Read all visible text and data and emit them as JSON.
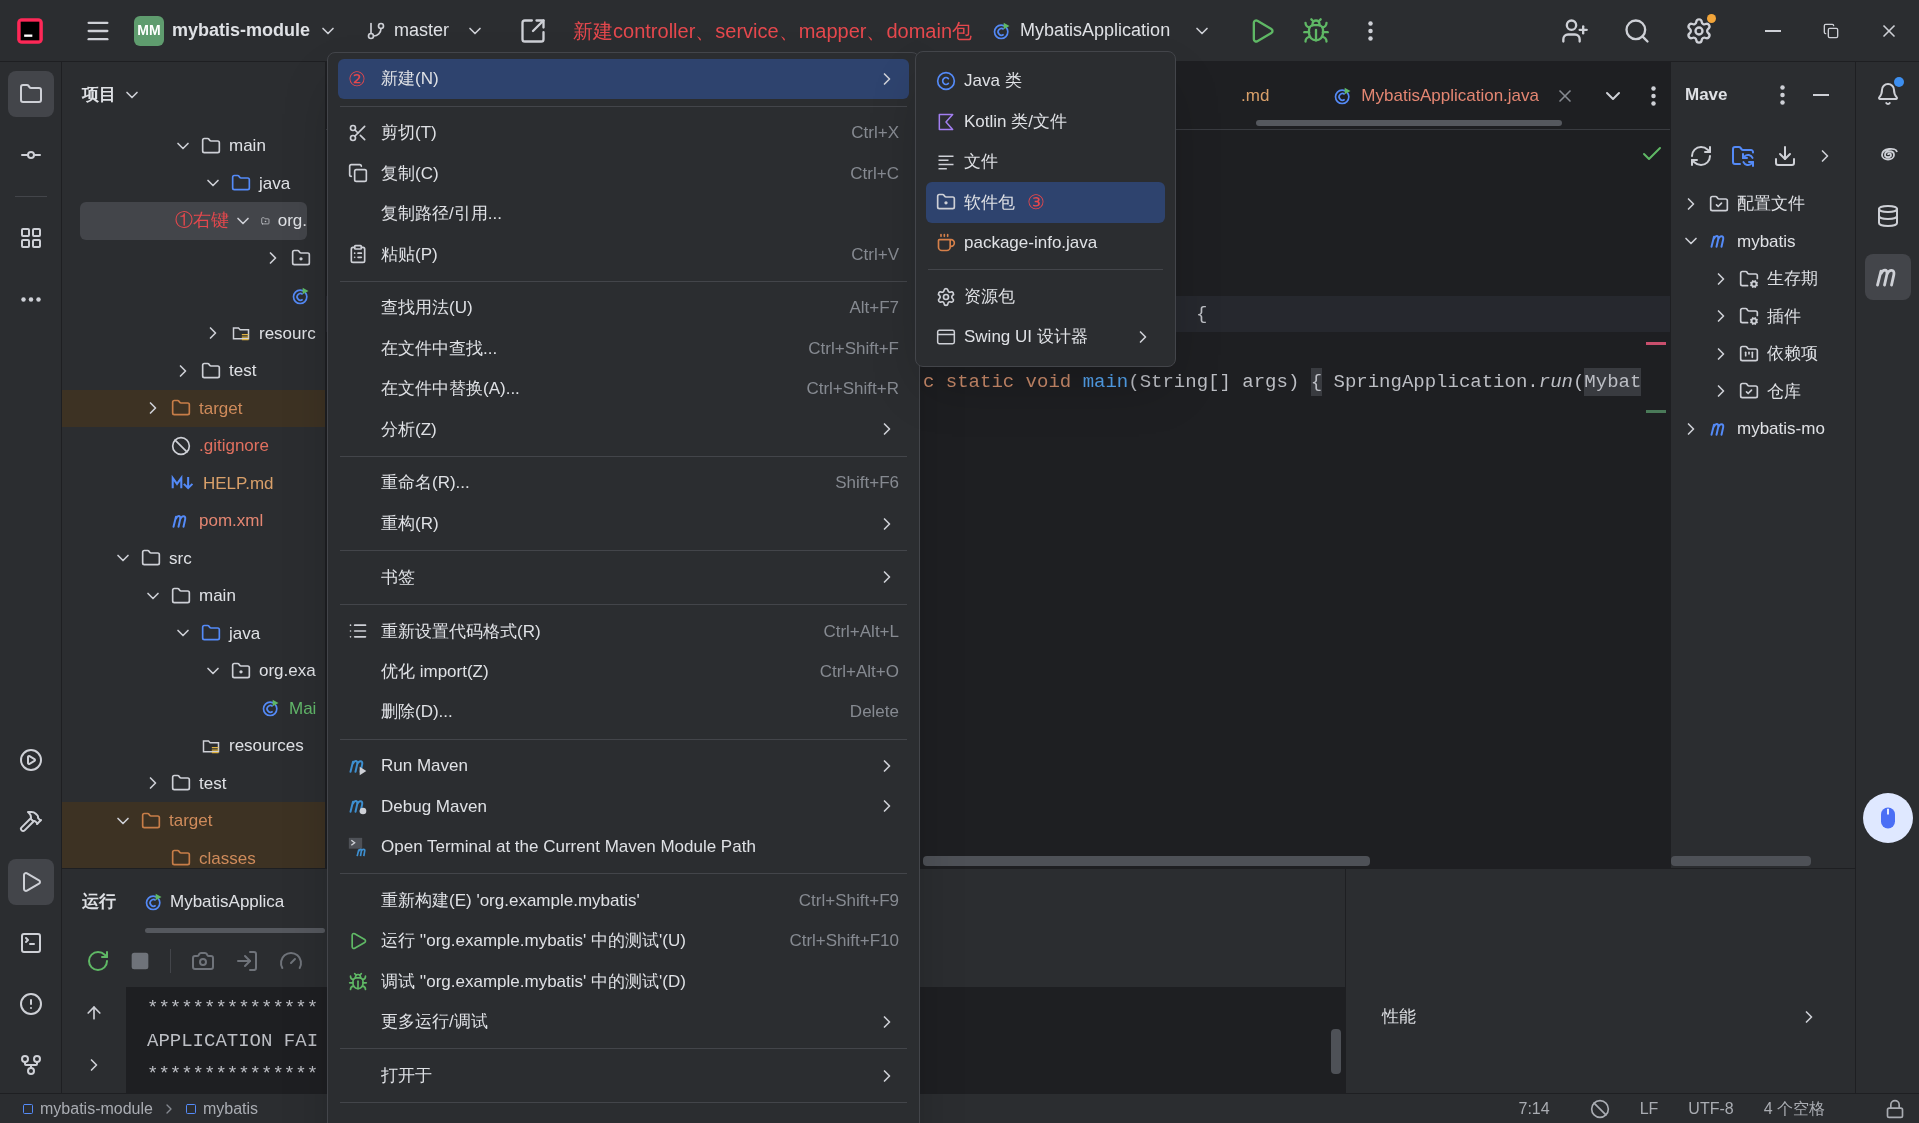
{
  "title_bar": {
    "project_badge": "MM",
    "project": "mybatis-module",
    "branch": "master",
    "annotation": "新建controller、service、mapper、domain包",
    "run_config": "MybatisApplication",
    "settings_badge": true
  },
  "left_toolbar": {
    "top": [
      {
        "kind": "project",
        "selected": true
      },
      {
        "kind": "commit",
        "selected": false
      },
      {
        "kind": "structure",
        "selected": false
      },
      {
        "kind": "more",
        "selected": false
      }
    ],
    "bottom": [
      {
        "kind": "services",
        "selected": false
      },
      {
        "kind": "build",
        "selected": false
      },
      {
        "kind": "run",
        "selected": true
      },
      {
        "kind": "terminal",
        "selected": false
      },
      {
        "kind": "problems",
        "selected": false
      },
      {
        "kind": "git",
        "selected": false
      }
    ]
  },
  "project_panel": {
    "title": "项目",
    "tree": [
      {
        "children": [
          {
            "children": [
              {
                "kind": "folder",
                "label": "main",
                "expanded": true,
                "selected": false,
                "children": [
                  {
                    "kind": "source",
                    "label": "java",
                    "expanded": true,
                    "selected": false,
                    "children": [
                      {
                        "kind": "package",
                        "label": "org.",
                        "expanded": true,
                        "selected": true,
                        "annotation": "①右键",
                        "children": [
                          {
                            "kind": "package",
                            "expanded": false,
                            "selected": false
                          },
                          {
                            "kind": "app_class",
                            "selected": false
                          }
                        ]
                      }
                    ]
                  },
                  {
                    "kind": "resources",
                    "label": "resourc",
                    "expanded": false,
                    "selected": false
                  }
                ]
              },
              {
                "kind": "folder",
                "label": "test",
                "expanded": false,
                "selected": false
              }
            ]
          },
          {
            "kind": "excluded",
            "label": "target",
            "expanded": false,
            "selected": false,
            "excluded": true,
            "color": "#cf8b5b"
          },
          {
            "kind": "gitignore",
            "label": ".gitignore",
            "selected": false,
            "color": "#e0705f"
          },
          {
            "kind": "markdown",
            "label": "HELP.md",
            "selected": false,
            "color": "#d9a06a"
          },
          {
            "kind": "maven",
            "label": "pom.xml",
            "selected": false,
            "color": "#e48672"
          }
        ]
      },
      {
        "kind": "folder",
        "label": "src",
        "expanded": true,
        "selected": false,
        "children": [
          {
            "kind": "folder",
            "label": "main",
            "expanded": true,
            "selected": false,
            "children": [
              {
                "kind": "source",
                "label": "java",
                "expanded": true,
                "selected": false,
                "children": [
                  {
                    "kind": "package",
                    "label": "org.exa",
                    "expanded": true,
                    "selected": false,
                    "children": [
                      {
                        "kind": "app_class",
                        "label": "Mai",
                        "selected": false,
                        "color": "#62b86a"
                      }
                    ]
                  }
                ]
              },
              {
                "kind": "resources",
                "label": "resources",
                "selected": false
              }
            ]
          },
          {
            "kind": "folder",
            "label": "test",
            "expanded": false,
            "selected": false
          }
        ]
      },
      {
        "kind": "excluded",
        "label": "target",
        "expanded": true,
        "selected": false,
        "excluded": true,
        "color": "#cf8b5b",
        "children": [
          {
            "kind": "excluded",
            "label": "classes",
            "selected": false,
            "excluded": true,
            "color": "#cf8b5b"
          }
        ]
      }
    ]
  },
  "editor": {
    "tabs": [
      {
        "label": ".md",
        "selected": false,
        "color": "#d9a06a"
      },
      {
        "label": "MybatisApplication.java",
        "selected": true,
        "color": "#e48672"
      }
    ],
    "lines": [
      {
        "current": true,
        "tokens": [
          {
            "kind": "plain",
            "text": "{"
          }
        ]
      },
      {
        "current": false,
        "tokens": [
          {
            "kind": "keyword",
            "text": "c static void "
          },
          {
            "kind": "function",
            "text": "main"
          },
          {
            "kind": "plain",
            "text": "(String[] args) "
          },
          {
            "kind": "fold",
            "text": "{"
          },
          {
            "kind": "plain",
            "text": " SpringApplication."
          },
          {
            "kind": "italic",
            "text": "run"
          },
          {
            "kind": "plain",
            "text": "("
          },
          {
            "kind": "fold",
            "text": "Mybat"
          }
        ]
      }
    ]
  },
  "maven_panel": {
    "title": "Mave",
    "tree": [
      {
        "kind": "config",
        "label": "配置文件",
        "expanded": false
      },
      {
        "kind": "module",
        "label": "mybatis",
        "expanded": true,
        "children": [
          {
            "kind": "lifecycle",
            "label": "生存期",
            "expanded": false
          },
          {
            "kind": "plugins",
            "label": "插件",
            "expanded": false
          },
          {
            "kind": "dependencies",
            "label": "依赖项",
            "expanded": false
          },
          {
            "kind": "repositories",
            "label": "仓库",
            "expanded": false
          }
        ]
      },
      {
        "kind": "module",
        "label": "mybatis-mo",
        "expanded": false
      }
    ]
  },
  "right_toolbar": [
    {
      "kind": "notifications",
      "badge": true,
      "selected": false
    },
    {
      "kind": "ai",
      "selected": false
    },
    {
      "kind": "database",
      "selected": false
    },
    {
      "kind": "maven",
      "selected": true
    }
  ],
  "run_panel": {
    "title": "运行",
    "tab": {
      "label": "MybatisApplica",
      "selected": true
    },
    "console": [
      "***************",
      "APPLICATION FAI",
      "***************"
    ],
    "side_panel": {
      "title": "性能"
    }
  },
  "status_bar": {
    "breadcrumbs": [
      "mybatis-module",
      "mybatis"
    ],
    "position": "7:14",
    "line_separator": "LF",
    "encoding": "UTF-8",
    "indent": "4 个空格"
  },
  "context_menu": {
    "items": [
      {
        "kind": "plain",
        "annotation": "②",
        "label": "新建(N)",
        "submenu": true,
        "selected": true
      },
      {
        "kind": "separator"
      },
      {
        "kind": "cut",
        "label": "剪切(T)",
        "shortcut": "Ctrl+X",
        "submenu": false,
        "selected": false
      },
      {
        "kind": "copy",
        "label": "复制(C)",
        "shortcut": "Ctrl+C",
        "submenu": false,
        "selected": false
      },
      {
        "kind": "plain",
        "label": "复制路径/引用...",
        "submenu": false,
        "selected": false
      },
      {
        "kind": "paste",
        "label": "粘贴(P)",
        "shortcut": "Ctrl+V",
        "submenu": false,
        "selected": false
      },
      {
        "kind": "separator"
      },
      {
        "kind": "plain",
        "label": "查找用法(U)",
        "shortcut": "Alt+F7",
        "submenu": false,
        "selected": false
      },
      {
        "kind": "plain",
        "label": "在文件中查找...",
        "shortcut": "Ctrl+Shift+F",
        "submenu": false,
        "selected": false
      },
      {
        "kind": "plain",
        "label": "在文件中替换(A)...",
        "shortcut": "Ctrl+Shift+R",
        "submenu": false,
        "selected": false
      },
      {
        "kind": "plain",
        "label": "分析(Z)",
        "submenu": true,
        "selected": false
      },
      {
        "kind": "separator"
      },
      {
        "kind": "plain",
        "label": "重命名(R)...",
        "shortcut": "Shift+F6",
        "submenu": false,
        "selected": false
      },
      {
        "kind": "plain",
        "label": "重构(R)",
        "submenu": true,
        "selected": false
      },
      {
        "kind": "separator"
      },
      {
        "kind": "plain",
        "label": "书签",
        "submenu": true,
        "selected": false
      },
      {
        "kind": "separator"
      },
      {
        "kind": "reformat",
        "label": "重新设置代码格式(R)",
        "shortcut": "Ctrl+Alt+L",
        "submenu": false,
        "selected": false
      },
      {
        "kind": "plain",
        "label": "优化 import(Z)",
        "shortcut": "Ctrl+Alt+O",
        "submenu": false,
        "selected": false
      },
      {
        "kind": "plain",
        "label": "删除(D)...",
        "shortcut": "Delete",
        "submenu": false,
        "selected": false
      },
      {
        "kind": "separator"
      },
      {
        "kind": "maven_run",
        "label": "Run Maven",
        "submenu": true,
        "selected": false
      },
      {
        "kind": "maven_debug",
        "label": "Debug Maven",
        "submenu": true,
        "selected": false
      },
      {
        "kind": "maven_terminal",
        "label": "Open Terminal at the Current Maven Module Path",
        "submenu": false,
        "selected": false
      },
      {
        "kind": "separator"
      },
      {
        "kind": "plain",
        "label": "重新构建(E) 'org.example.mybatis'",
        "shortcut": "Ctrl+Shift+F9",
        "submenu": false,
        "selected": false
      },
      {
        "kind": "run",
        "label": "运行 ''org.example.mybatis' 中的测试'(U)",
        "shortcut": "Ctrl+Shift+F10",
        "submenu": false,
        "selected": false
      },
      {
        "kind": "debug",
        "label": "调试 ''org.example.mybatis' 中的测试'(D)",
        "submenu": false,
        "selected": false
      },
      {
        "kind": "plain",
        "label": "更多运行/调试",
        "submenu": true,
        "selected": false
      },
      {
        "kind": "separator"
      },
      {
        "kind": "plain",
        "label": "打开于",
        "submenu": true,
        "selected": false
      },
      {
        "kind": "separator"
      }
    ]
  },
  "submenu": {
    "items": [
      {
        "kind": "java_class",
        "label": "Java 类",
        "submenu": false,
        "selected": false
      },
      {
        "kind": "kotlin",
        "label": "Kotlin 类/文件",
        "submenu": false,
        "selected": false
      },
      {
        "kind": "file",
        "label": "文件",
        "submenu": false,
        "selected": false
      },
      {
        "kind": "package",
        "label": "软件包",
        "annotation": "③",
        "submenu": false,
        "selected": true
      },
      {
        "kind": "package_info",
        "label": "package-info.java",
        "submenu": false,
        "selected": false
      },
      {
        "kind": "separator"
      },
      {
        "kind": "resource_bundle",
        "label": "资源包",
        "submenu": false,
        "selected": false
      },
      {
        "kind": "swing",
        "label": "Swing UI 设计器",
        "submenu": true,
        "selected": false
      }
    ]
  }
}
